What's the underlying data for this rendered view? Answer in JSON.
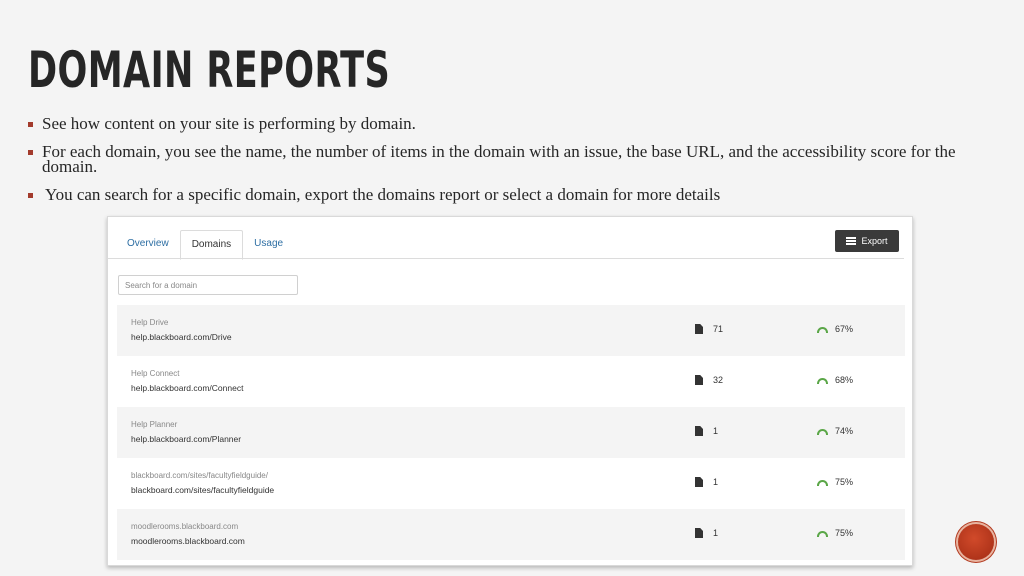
{
  "slide": {
    "title": "Domain Reports",
    "bullets": [
      "See how content on your site is performing by domain.",
      "For each domain, you see the name, the number of items in the domain with an issue, the base URL, and the accessibility score for the domain.",
      "You can search for a specific domain, export the domains report or select a domain for more details"
    ]
  },
  "app": {
    "tabs": [
      {
        "label": "Overview",
        "active": false
      },
      {
        "label": "Domains",
        "active": true
      },
      {
        "label": "Usage",
        "active": false
      }
    ],
    "export_label": "Export",
    "search": {
      "placeholder": "Search for a domain",
      "value": ""
    },
    "domains": [
      {
        "name": "Help Drive",
        "url": "help.blackboard.com/Drive",
        "issues": "71",
        "score": "67%"
      },
      {
        "name": "Help Connect",
        "url": "help.blackboard.com/Connect",
        "issues": "32",
        "score": "68%"
      },
      {
        "name": "Help Planner",
        "url": "help.blackboard.com/Planner",
        "issues": "1",
        "score": "74%"
      },
      {
        "name": "blackboard.com/sites/facultyfieldguide/",
        "url": "blackboard.com/sites/facultyfieldguide",
        "issues": "1",
        "score": "75%"
      },
      {
        "name": "moodlerooms.blackboard.com",
        "url": "moodlerooms.blackboard.com",
        "issues": "1",
        "score": "75%"
      }
    ]
  },
  "colors": {
    "accent": "#a33b2c",
    "link": "#2d6ea3",
    "gauge": "#5aa647",
    "button": "#3a3a3a"
  },
  "icons": {
    "doc": "document-icon",
    "gauge": "gauge-icon",
    "export": "list-icon",
    "logo": "logo-circle"
  }
}
